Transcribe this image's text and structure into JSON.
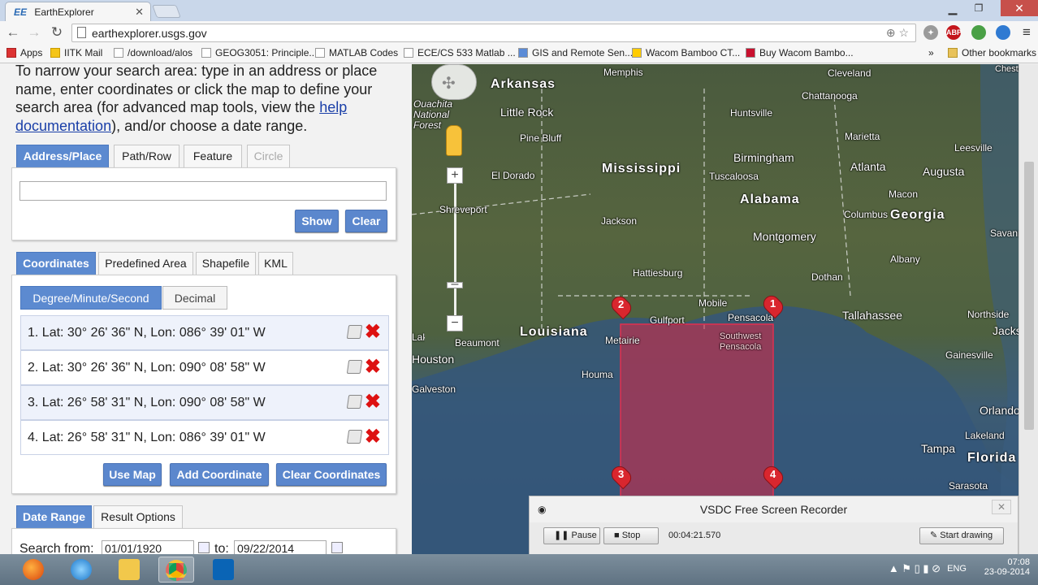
{
  "browser": {
    "tab_title": "EarthExplorer",
    "tab_icon": "EE",
    "url": "earthexplorer.usgs.gov",
    "bookmarks": [
      "Apps",
      "IITK Mail",
      "/download/alos",
      "GEOG3051: Principle...",
      "MATLAB Codes",
      "ECE/CS 533 Matlab ...",
      "GIS and Remote Sen...",
      "Wacom Bamboo CT...",
      "Buy Wacom Bambo..."
    ],
    "overflow": "»",
    "other_bookmarks": "Other bookmarks"
  },
  "search": {
    "intro_before": "To narrow your search area: type in an address or place name, enter coordinates or click the map to define your search area (for advanced map tools, view the ",
    "intro_link": "help documentation",
    "intro_after": "), and/or choose a date range."
  },
  "address_tabs": [
    "Address/Place",
    "Path/Row",
    "Feature",
    "Circle"
  ],
  "address_buttons": {
    "show": "Show",
    "clear": "Clear"
  },
  "coord_tabs": [
    "Coordinates",
    "Predefined Area",
    "Shapefile",
    "KML"
  ],
  "coord_format": {
    "dms": "Degree/Minute/Second",
    "decimal": "Decimal"
  },
  "coordinates": [
    "1.  Lat: 30° 26' 36\" N, Lon: 086° 39' 01\" W",
    "2.  Lat: 30° 26' 36\" N, Lon: 090° 08' 58\" W",
    "3.  Lat: 26° 58' 31\" N, Lon: 090° 08' 58\" W",
    "4.  Lat: 26° 58' 31\" N, Lon: 086° 39' 01\" W"
  ],
  "coord_buttons": {
    "use_map": "Use Map",
    "add": "Add Coordinate",
    "clear": "Clear Coordinates"
  },
  "date_tabs": [
    "Date Range",
    "Result Options"
  ],
  "date": {
    "from_label": "Search from:",
    "from": "01/01/1920",
    "to_label": "to:",
    "to": "09/22/2014"
  },
  "map": {
    "states": [
      "Arkansas",
      "Mississippi",
      "Alabama",
      "Georgia",
      "Louisiana",
      "Florida"
    ],
    "cities": [
      "Memphis",
      "Cleveland",
      "Chattanooga",
      "Little Rock",
      "Huntsville",
      "Marietta",
      "Leesville",
      "Pine Bluff",
      "Birmingham",
      "Atlanta",
      "Augusta",
      "El Dorado",
      "Tuscaloosa",
      "Macon",
      "Shreveport",
      "Jackson",
      "Columbus",
      "Savannah",
      "Montgomery",
      "Albany",
      "Hattiesburg",
      "Dothan",
      "Mobile",
      "Pensacola",
      "Tallahassee",
      "Northside",
      "Gulfport",
      "Metairie",
      "Southwest Pensacola",
      "Jacksonville",
      "Beaumont",
      "Houston",
      "Gainesville",
      "Houma",
      "Galveston",
      "Orlando",
      "Lakeland",
      "Tampa",
      "Sarasota",
      "Ouachita National Forest",
      "Chester",
      "Lake Charles"
    ],
    "markers": [
      "1",
      "2",
      "3",
      "4"
    ]
  },
  "recorder": {
    "title": "VSDC Free Screen Recorder",
    "pause": "Pause",
    "stop": "Stop",
    "time": "00:04:21.570",
    "start_drawing": "Start drawing"
  },
  "taskbar": {
    "lang": "ENG",
    "time": "07:08",
    "date": "23-09-2014"
  }
}
